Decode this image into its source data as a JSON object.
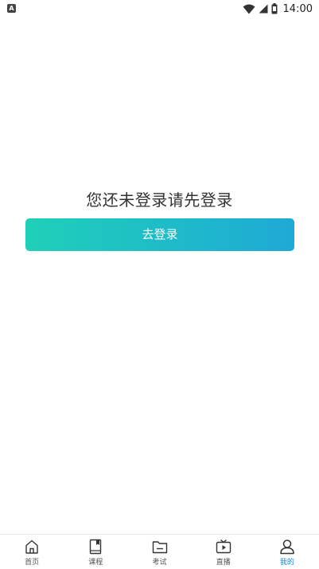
{
  "status_bar": {
    "left_icon_letter": "A",
    "left_icon": "notification-a-icon",
    "time": "14:00",
    "icons": [
      "wifi-icon",
      "cellular-signal-icon",
      "battery-icon"
    ]
  },
  "main": {
    "prompt": "您还未登录请先登录",
    "login_button_label": "去登录",
    "button_gradient": [
      "#1fd0b8",
      "#1ea9d6"
    ]
  },
  "tab_bar": {
    "active_color": "#1e88e5",
    "items": [
      {
        "label": "首页",
        "icon": "home-icon"
      },
      {
        "label": "课程",
        "icon": "book-icon"
      },
      {
        "label": "考试",
        "icon": "folder-icon"
      },
      {
        "label": "直播",
        "icon": "tv-play-icon"
      },
      {
        "label": "我的",
        "icon": "user-icon",
        "active": true
      }
    ]
  }
}
